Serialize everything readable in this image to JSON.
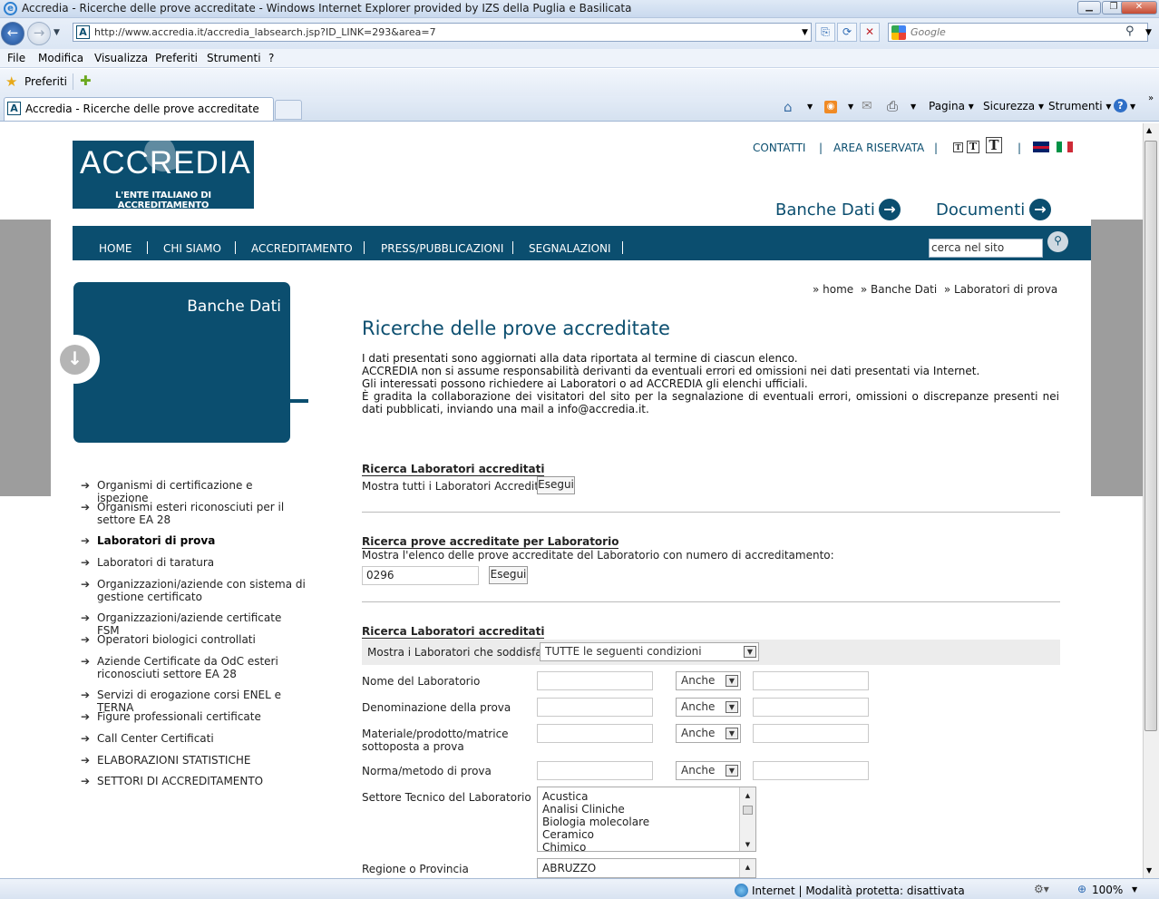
{
  "browser": {
    "window_title": "Accredia - Ricerche delle prove accreditate - Windows Internet Explorer provided by IZS della Puglia e Basilicata",
    "url": "http://www.accredia.it/accredia_labsearch.jsp?ID_LINK=293&area=7",
    "search_placeholder": "Google",
    "menu": [
      "File",
      "Modifica",
      "Visualizza",
      "Preferiti",
      "Strumenti",
      "?"
    ],
    "favorites_label": "Preferiti",
    "tab_title": "Accredia - Ricerche delle prove accreditate",
    "tools": {
      "page": "Pagina",
      "security": "Sicurezza",
      "tools": "Strumenti"
    },
    "status": "Internet | Modalità protetta: disattivata",
    "zoom": "100%"
  },
  "site": {
    "logo_text": "ACCREDIA",
    "logo_subtitle": "L'ENTE ITALIANO DI ACCREDITAMENTO",
    "top_links": [
      "CONTATTI",
      "AREA RISERVATA"
    ],
    "text_size_labels": [
      "T",
      "T",
      "T"
    ],
    "big_menu": [
      "Banche Dati",
      "Documenti"
    ],
    "nav": [
      "HOME",
      "CHI SIAMO",
      "ACCREDITAMENTO",
      "PRESS/PUBBLICAZIONI",
      "SEGNALAZIONI"
    ],
    "site_search_value": "cerca nel sito"
  },
  "sidebar": {
    "title": "Banche Dati",
    "items": [
      {
        "label": "Organismi di certificazione e ispezione",
        "active": false
      },
      {
        "label": "Organismi esteri riconosciuti per il settore EA 28",
        "active": false
      },
      {
        "label": "Laboratori di prova",
        "active": true
      },
      {
        "label": "Laboratori di taratura",
        "active": false
      },
      {
        "label": "Organizzazioni/aziende con sistema di gestione certificato",
        "active": false
      },
      {
        "label": "Organizzazioni/aziende certificate FSM",
        "active": false
      },
      {
        "label": "Operatori biologici controllati",
        "active": false
      },
      {
        "label": "Aziende Certificate da OdC esteri riconosciuti settore EA 28",
        "active": false
      },
      {
        "label": "Servizi di erogazione corsi ENEL e TERNA",
        "active": false
      },
      {
        "label": "Figure professionali certificate",
        "active": false
      },
      {
        "label": "Call Center Certificati",
        "active": false
      },
      {
        "label": "ELABORAZIONI STATISTICHE",
        "active": false
      },
      {
        "label": "SETTORI DI ACCREDITAMENTO",
        "active": false
      }
    ]
  },
  "main": {
    "breadcrumb": [
      "home",
      "Banche Dati",
      "Laboratori di prova"
    ],
    "title": "Ricerche delle prove accreditate",
    "intro": [
      "I dati presentati sono aggiornati alla data riportata al termine di ciascun elenco.",
      "ACCREDIA non si assume responsabilità derivanti da eventuali errori ed omissioni nei dati presentati via Internet.",
      "Gli interessati possono richiedere ai Laboratori o ad ACCREDIA gli elenchi ufficiali.",
      "È gradita la collaborazione dei visitatori del sito per la segnalazione di eventuali errori, omissioni o discrepanze presenti nei dati pubblicati, inviando una mail a info@accredia.it."
    ],
    "section1": {
      "title": "Ricerca Laboratori accreditati",
      "text": "Mostra tutti i Laboratori Accreditati",
      "button": "Esegui"
    },
    "section2": {
      "title": "Ricerca prove accreditate per Laboratorio",
      "text": "Mostra l'elenco delle prove accreditate del Laboratorio con numero di accreditamento:",
      "input_value": "0296",
      "button": "Esegui"
    },
    "section3": {
      "title": "Ricerca Laboratori accreditati",
      "condition_label": "Mostra i Laboratori che soddisfano",
      "condition_value": "TUTTE le seguenti condizioni",
      "fields": [
        {
          "label": "Nome del Laboratorio",
          "operator": "Anche"
        },
        {
          "label": "Denominazione della prova",
          "operator": "Anche"
        },
        {
          "label": "Materiale/prodotto/matrice sottoposta a prova",
          "operator": "Anche"
        },
        {
          "label": "Norma/metodo di prova",
          "operator": "Anche"
        }
      ],
      "sector_label": "Settore Tecnico del Laboratorio",
      "sector_options": [
        "Acustica",
        "Analisi Cliniche",
        "Biologia molecolare",
        "Ceramico",
        "Chimico"
      ],
      "region_label": "Regione o Provincia",
      "region_options": [
        "ABRUZZO"
      ]
    }
  }
}
